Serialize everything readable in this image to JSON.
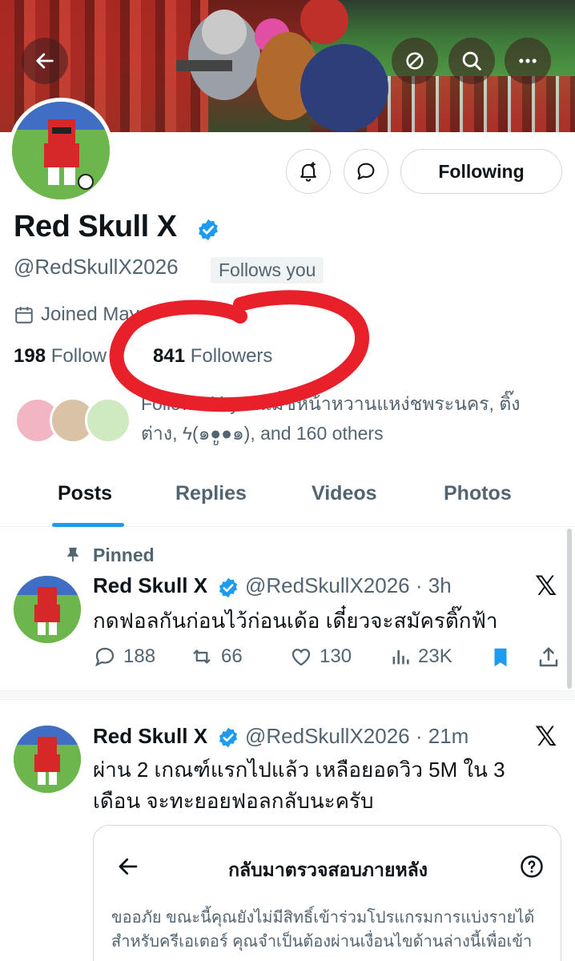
{
  "header": {
    "back_icon": "arrow-left-icon",
    "actions": [
      "link-off-icon",
      "search-icon",
      "more-icon"
    ]
  },
  "profile": {
    "name": "Red Skull X",
    "handle": "@RedSkullX2026",
    "follows_you": "Follows you",
    "joined": "Joined May",
    "following_count": "198",
    "following_label": "Follow",
    "followers_count": "841",
    "followers_label": "Followers",
    "followed_by_line1": "Followed by ...แม่๊ชหน้าหวานแหง่ชพระนคร, ติ๊ง",
    "followed_by_line2": "ต่าง, ϟ(๑●ູ●๑), and 160 others",
    "buttons": {
      "following": "Following"
    }
  },
  "tabs": [
    "Posts",
    "Replies",
    "Videos",
    "Photos"
  ],
  "posts": [
    {
      "pinned_label": "Pinned",
      "name": "Red Skull X",
      "handle_time": "@RedSkullX2026 · 3h",
      "text": "กดฟอลกันก่อนไว้ก่อนเด้อ เดี๋ยวจะสมัครติ๊กฟ้า",
      "replies": "188",
      "reposts": "66",
      "likes": "130",
      "views": "23K"
    },
    {
      "name": "Red Skull X",
      "handle_time": "@RedSkullX2026 · 21m",
      "text_line1": "ผ่าน 2 เกณฑ์แรกไปแล้ว เหลือยอดวิว 5M ใน 3",
      "text_line2": "เดือน จะทะยอยฟอลกลับนะครับ",
      "card": {
        "title": "กลับมาตรวจสอบภายหลัง",
        "body_line1": "ขออภัย ขณะนี้คุณยังไม่มีสิทธิ์เข้าร่วมโปรแกรมการแบ่งรายได้",
        "body_line2": "สำหรับครีเอเตอร์ คุณจำเป็นต้องผ่านเงื่อนไขด้านล่างนี้เพื่อเข้า"
      }
    }
  ],
  "colors": {
    "accent": "#1d9bf0",
    "annotation": "#e8202a",
    "muted": "#536471"
  }
}
